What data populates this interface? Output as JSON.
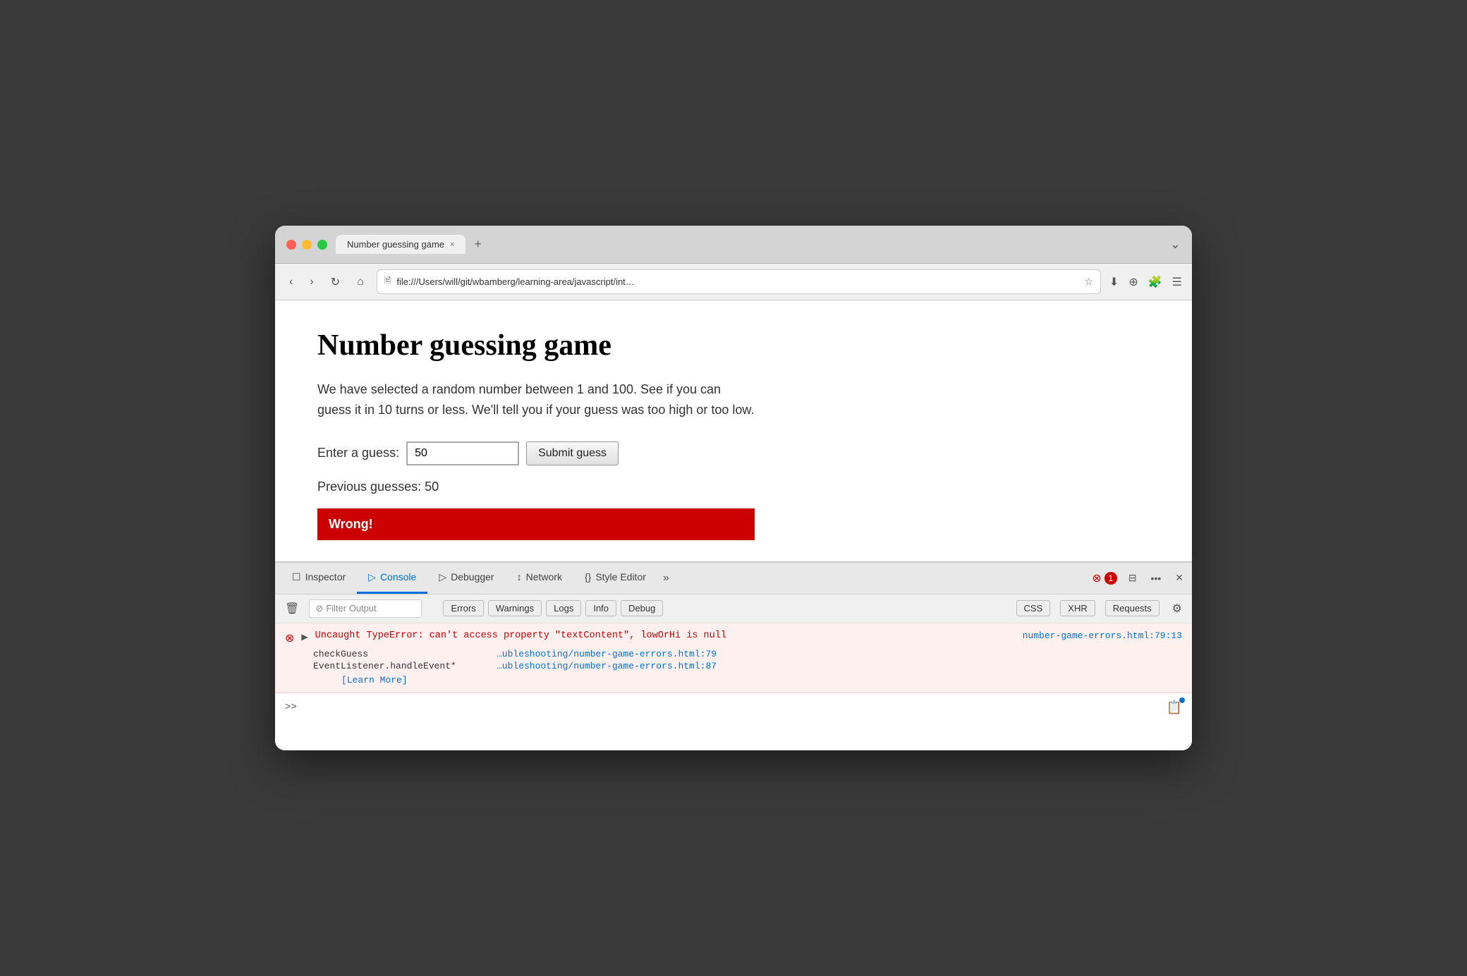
{
  "browser": {
    "tab_title": "Number guessing game",
    "tab_close": "×",
    "tab_new": "+",
    "tab_dropdown": "⌄",
    "back_btn": "‹",
    "forward_btn": "›",
    "reload_btn": "↻",
    "home_btn": "⌂",
    "url": "file:///Users/will/git/wbamberg/learning-area/javascript/int…",
    "star_icon": "☆",
    "download_icon": "⬇",
    "rss_icon": "⊕",
    "extensions_icon": "🧩",
    "menu_icon": "☰"
  },
  "page": {
    "title": "Number guessing game",
    "description": "We have selected a random number between 1 and 100. See if you can guess it in 10 turns or less. We'll tell you if your guess was too high or too low.",
    "guess_label": "Enter a guess:",
    "guess_value": "50",
    "submit_label": "Submit guess",
    "previous_guesses_label": "Previous guesses:",
    "previous_guesses_value": "50",
    "wrong_banner": "Wrong!"
  },
  "devtools": {
    "tabs": [
      {
        "id": "inspector",
        "label": "Inspector",
        "icon": "☐",
        "active": false
      },
      {
        "id": "console",
        "label": "Console",
        "icon": "▷",
        "active": true
      },
      {
        "id": "debugger",
        "label": "Debugger",
        "icon": "▷",
        "active": false
      },
      {
        "id": "network",
        "label": "Network",
        "icon": "↕",
        "active": false
      },
      {
        "id": "style-editor",
        "label": "Style Editor",
        "icon": "{}",
        "active": false
      }
    ],
    "more_tabs": "»",
    "error_count": "1",
    "toolbar": {
      "clear_btn": "🗑",
      "filter_placeholder": "Filter Output",
      "filter_icon": "⊘",
      "pills": [
        "Errors",
        "Warnings",
        "Logs",
        "Info",
        "Debug"
      ],
      "css_label": "CSS",
      "xhr_label": "XHR",
      "requests_label": "Requests",
      "settings_icon": "⚙"
    },
    "console_entries": [
      {
        "type": "error",
        "message": "Uncaught TypeError: can't access property \"textContent\", lowOrHi is null",
        "location": "number-game-errors.html:79:13",
        "stack": [
          {
            "fn": "checkGuess",
            "loc": "…ubleshooting/number-game-errors.html:79"
          },
          {
            "fn": "EventListener.handleEvent*",
            "loc": "…ubleshooting/number-game-errors.html:87"
          }
        ],
        "learn_more": "[Learn More]"
      }
    ],
    "console_prompt": ">>",
    "sidebar_icon": "📋"
  }
}
